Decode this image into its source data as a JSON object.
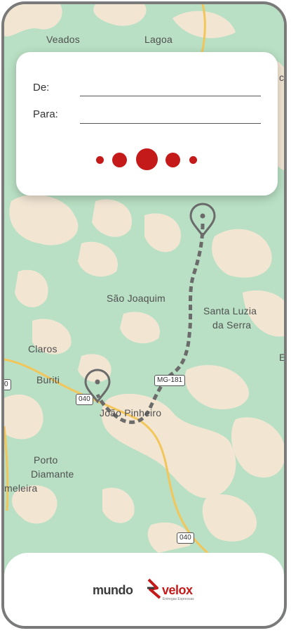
{
  "map": {
    "labels": {
      "veados": "Veados",
      "lagoa": "Lagoa",
      "sao_joaquim": "São Joaquim",
      "santa_luzia_1": "Santa Luzia",
      "santa_luzia_2": "da Serra",
      "claros": "Claros",
      "buriti": "Buriti",
      "joao_pinheiro": "João Pinheiro",
      "porto_1": "Porto",
      "porto_2": "Diamante",
      "meleira": "meleira",
      "edge_e": "E",
      "edge_ca": "ca"
    },
    "road_badges": {
      "mg181": "MG-181",
      "r040_a": "040",
      "r040_b": "040",
      "left_edge": "0"
    }
  },
  "route_form": {
    "from_label": "De:",
    "to_label": "Para:",
    "from_value": "",
    "to_value": "",
    "loading_dots": 5
  },
  "footer": {
    "logo": {
      "mundo": "mundo",
      "velox": "velox",
      "tagline": "Entregas Expressas"
    }
  },
  "colors": {
    "accent": "#c41a1a",
    "map_bg": "#b9e0c4",
    "map_land": "#f2e6d3",
    "road": "#f2c65a",
    "route": "#6b6b6b"
  },
  "icons": {
    "origin_pin": "map-pin-icon",
    "destination_pin": "map-pin-icon"
  }
}
